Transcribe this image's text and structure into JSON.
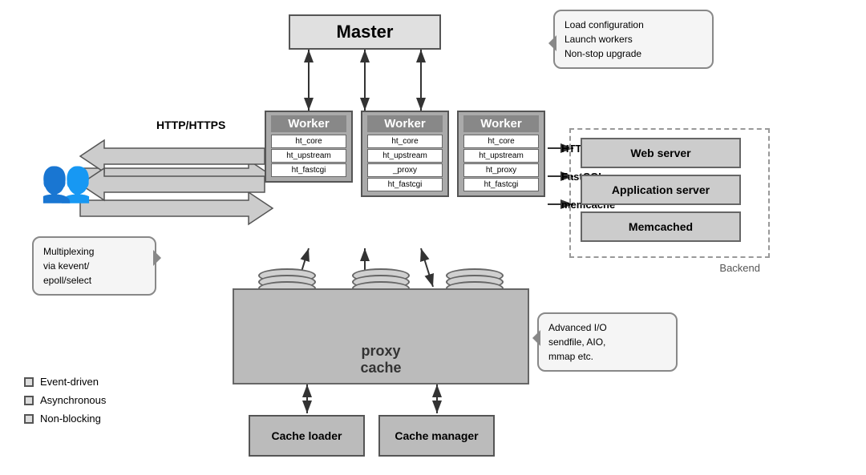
{
  "master": {
    "label": "Master"
  },
  "workers": [
    {
      "title": "Worker",
      "modules": [
        "ht_core",
        "ht_upstream",
        "ht_fastcgi"
      ]
    },
    {
      "title": "Worker",
      "modules": [
        "ht_core",
        "ht_upstream",
        "_proxy",
        "ht_fastcgi"
      ]
    },
    {
      "title": "Worker",
      "modules": [
        "ht_core",
        "ht_upstream",
        "ht_proxy",
        "ht_fastcgi"
      ]
    }
  ],
  "backend": {
    "label": "Backend",
    "servers": [
      "Web server",
      "Application server",
      "Memcached"
    ]
  },
  "proxy_cache": {
    "label": "proxy\ncache"
  },
  "cache_loader": {
    "label": "Cache loader"
  },
  "cache_manager": {
    "label": "Cache manager"
  },
  "callouts": {
    "master_bubble": "Load configuration\nLaunch workers\nNon-stop upgrade",
    "io_bubble": "Advanced I/O\nsendfile, AIO,\nmmap etc.",
    "multiplex_bubble": "Multiplexing\nvia kevent/\nepoll/select"
  },
  "labels": {
    "http_https": "HTTP/HTTPS",
    "http": "HTTP",
    "fastcgi": "FastCGI",
    "memcache": "memcache"
  },
  "legend": {
    "items": [
      "Event-driven",
      "Asynchronous",
      "Non-blocking"
    ]
  }
}
